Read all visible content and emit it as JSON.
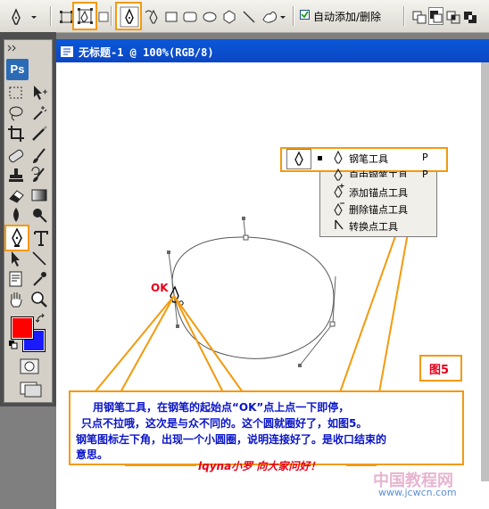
{
  "options_bar": {
    "auto_add_delete_label": "自动添加/删除",
    "auto_add_delete_checked": true
  },
  "toolbox": {
    "logo": "Ps"
  },
  "document": {
    "title": "无标题-1 @ 100%(RGB/8)"
  },
  "context_menu": {
    "items": [
      {
        "label": "钢笔工具",
        "shortcut": "P",
        "icon": "pen-icon"
      },
      {
        "label": "自由钢笔工具",
        "shortcut": "P",
        "icon": "freeform-pen-icon"
      },
      {
        "label": "添加锚点工具",
        "shortcut": "",
        "icon": "add-anchor-icon"
      },
      {
        "label": "删除锚点工具",
        "shortcut": "",
        "icon": "delete-anchor-icon"
      },
      {
        "label": "转换点工具",
        "shortcut": "",
        "icon": "convert-point-icon"
      }
    ]
  },
  "annotation": {
    "ok_label": "OK",
    "figure_label": "图5",
    "line1": "用钢笔工具，在钢笔的起始点“OK”点上点一下即停，",
    "line2": "只点不拉哦，这次是与众不同的。这个圆就圈好了，如图5。",
    "line3": "钢笔图标左下角，出现一个小圆圈，说明连接好了。是收口结束的",
    "line4": "意思。",
    "signature": "lqyna小罗 向大家问好！"
  },
  "watermark": {
    "line1": "中国教程网",
    "line2": "www.jcwcn.com"
  },
  "colors": {
    "highlight": "#f39a0d",
    "title_bar": "#0b46c4",
    "annotation_blue": "#0a14c8",
    "annotation_red": "#e6001a",
    "foreground": "#ff0000",
    "background": "#1a1aff"
  }
}
